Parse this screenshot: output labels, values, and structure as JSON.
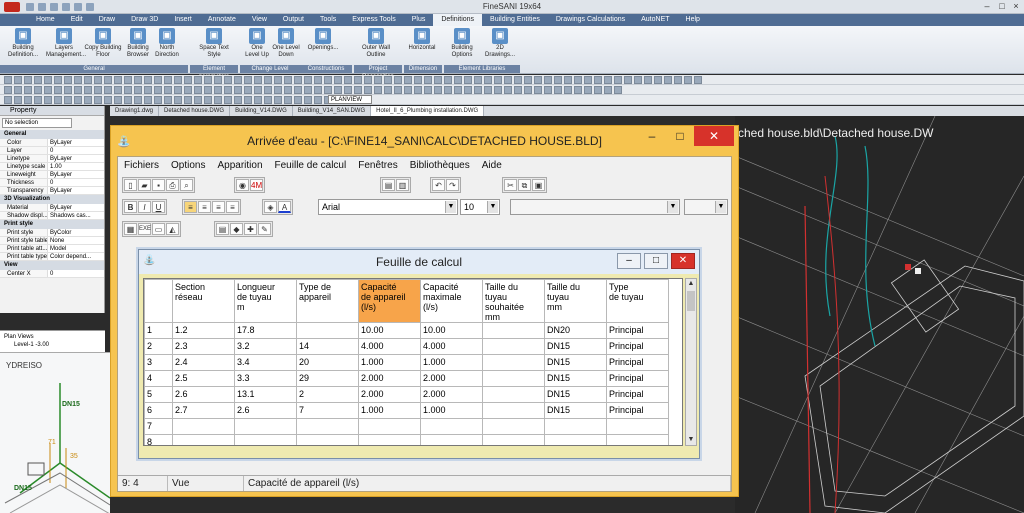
{
  "app": {
    "title": "FineSANI 19x64",
    "menu_tabs": [
      "Home",
      "Edit",
      "Draw",
      "Draw 3D",
      "Insert",
      "Annotate",
      "View",
      "Output",
      "Tools",
      "Express Tools",
      "Plus",
      "Definitions",
      "Building Entities",
      "Drawings Calculations",
      "AutoNET",
      "Help"
    ],
    "active_tab": "Definitions"
  },
  "ribbon": {
    "buttons": [
      {
        "label": "Building\nDefinition...",
        "icon": "building-icon"
      },
      {
        "label": "Layers\nManagement...",
        "icon": "layers-icon"
      },
      {
        "label": "Copy Building\nFloor",
        "icon": "copy-floor-icon"
      },
      {
        "label": "Building\nBrowser",
        "icon": "browser-icon"
      },
      {
        "label": "North\nDirection",
        "icon": "north-icon"
      },
      {
        "label": "Space Text\nStyle",
        "icon": "text-style-icon"
      },
      {
        "label": "One\nLevel Up",
        "icon": "level-up-icon"
      },
      {
        "label": "One Level\nDown",
        "icon": "level-down-icon"
      },
      {
        "label": "Openings...",
        "icon": "openings-icon"
      },
      {
        "label": "Outer Wall\nOutline",
        "icon": "outer-wall-icon"
      },
      {
        "label": "Horizontal",
        "icon": "horizontal-icon"
      },
      {
        "label": "Building\nOptions",
        "icon": "options-icon"
      },
      {
        "label": "2D\nDrawings...",
        "icon": "drawings-2d-icon"
      }
    ],
    "groups": [
      "General",
      "Element parameters",
      "Change Level",
      "Constructions",
      "Project Recognition",
      "Dimension",
      "Element Libraries"
    ]
  },
  "doc_tabs": [
    "Drawing1.dwg",
    "Detached house.DWG",
    "Building_V14.DWG",
    "Building_V14_SAN.DWG",
    "Hotel_II_6_Plumbing installation.DWG"
  ],
  "active_doc": "Hotel_II_6_Plumbing installation.DWG",
  "view_combo": "PLANVIEW",
  "properties": {
    "title": "Property",
    "selection": "No selection",
    "sections": [
      {
        "name": "General",
        "rows": [
          [
            "Color",
            "ByLayer"
          ],
          [
            "Layer",
            "0"
          ],
          [
            "Linetype",
            "ByLayer"
          ],
          [
            "Linetype scale",
            "1.00"
          ],
          [
            "Lineweight",
            "ByLayer"
          ],
          [
            "Thickness",
            "0"
          ],
          [
            "Transparency",
            "ByLayer"
          ]
        ]
      },
      {
        "name": "3D Visualization",
        "rows": [
          [
            "Material",
            "ByLayer"
          ],
          [
            "Shadow displ...",
            "Shadows cas..."
          ]
        ]
      },
      {
        "name": "Print style",
        "rows": [
          [
            "Print style",
            "ByColor"
          ],
          [
            "Print style table",
            "None"
          ],
          [
            "Print table att...",
            "Model"
          ],
          [
            "Print table type",
            "Color depend..."
          ]
        ]
      },
      {
        "name": "View",
        "rows": [
          [
            "Center X",
            "0"
          ]
        ]
      }
    ]
  },
  "tree": {
    "root": "Plan Views",
    "child": "Level-1 -3.00"
  },
  "left_view": {
    "label": "YDREISO",
    "dn1": "DN15",
    "dn2": "DN15",
    "n1": "71",
    "n2": "35"
  },
  "cad_title": "ched house.bld\\Detached house.DW",
  "main_window": {
    "title": "Arrivée d'eau - [C:\\FINE14_SANI\\CALC\\DETACHED HOUSE.BLD]",
    "menu": [
      "Fichiers",
      "Options",
      "Apparition",
      "Feuille de calcul",
      "Fenêtres",
      "Bibliothèques",
      "Aide"
    ],
    "font_name": "Arial",
    "font_size": "10"
  },
  "sheet": {
    "title": "Feuille de calcul",
    "columns": [
      "Section\nréseau",
      "Longueur\nde tuyau\nm",
      "Type de\nappareil",
      "Capacité\nde appareil\n(l/s)",
      "Capacité\nmaximale\n(l/s)",
      "Taille du tuyau\nsouhaitée\nmm",
      "Taille du\ntuyau\nmm",
      "Type\nde tuyau"
    ],
    "rows": [
      [
        "1",
        "1.2",
        "17.8",
        "",
        "10.00",
        "10.00",
        "",
        "DN20",
        "Principal"
      ],
      [
        "2",
        "2.3",
        "3.2",
        "14",
        "4.000",
        "4.000",
        "",
        "DN15",
        "Principal"
      ],
      [
        "3",
        "2.4",
        "3.4",
        "20",
        "1.000",
        "1.000",
        "",
        "DN15",
        "Principal"
      ],
      [
        "4",
        "2.5",
        "3.3",
        "29",
        "2.000",
        "2.000",
        "",
        "DN15",
        "Principal"
      ],
      [
        "5",
        "2.6",
        "13.1",
        "2",
        "2.000",
        "2.000",
        "",
        "DN15",
        "Principal"
      ],
      [
        "6",
        "2.7",
        "2.6",
        "7",
        "1.000",
        "1.000",
        "",
        "DN15",
        "Principal"
      ],
      [
        "7",
        "",
        "",
        "",
        "",
        "",
        "",
        "",
        ""
      ],
      [
        "8",
        "",
        "",
        "",
        "",
        "",
        "",
        "",
        ""
      ]
    ]
  },
  "status": {
    "cell": "9: 4",
    "mode": "Vue",
    "field": "Capacité de appareil (l/s)"
  },
  "colors": {
    "accent": "#f6c44f",
    "highlight": "#f7a44a",
    "close": "#d7322a"
  }
}
